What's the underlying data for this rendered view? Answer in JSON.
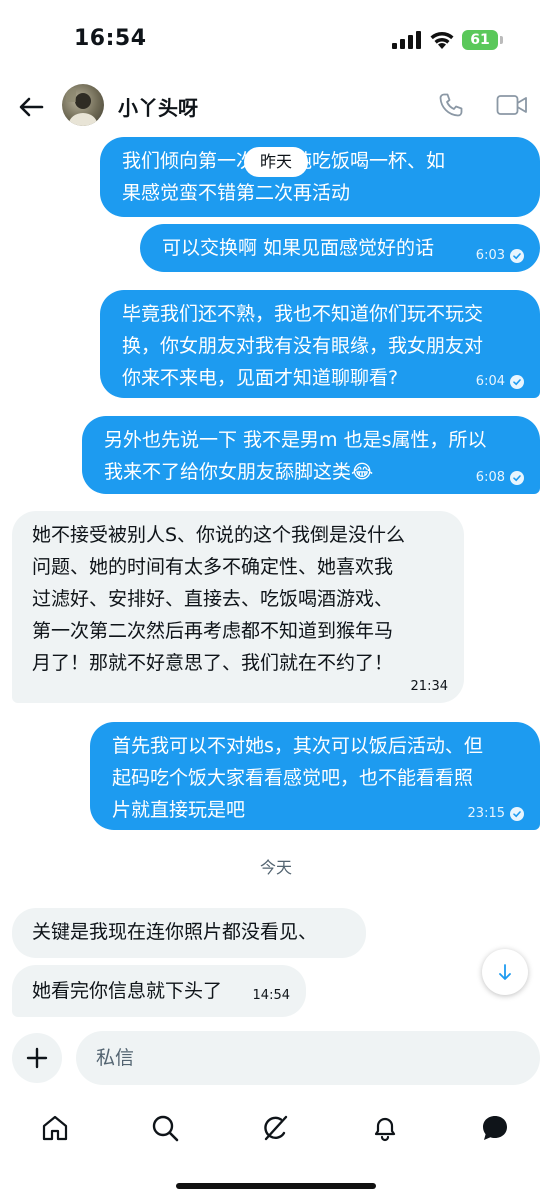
{
  "status_bar": {
    "time": "16:54",
    "battery": "61"
  },
  "header": {
    "contact_name": "小丫头呀",
    "back_icon": "arrow-left-icon",
    "call_icon": "phone-icon",
    "video_icon": "video-camera-icon"
  },
  "day_labels": {
    "yesterday": "昨天",
    "today": "今天"
  },
  "messages": [
    {
      "direction": "out",
      "lines": [
        "我们倾向第一次就单纯吃饭喝一杯、如",
        "果感觉蛮不错第二次再活动"
      ],
      "time": ""
    },
    {
      "direction": "out",
      "lines": [
        "可以交换啊 如果见面感觉好的话"
      ],
      "time": "6:03"
    },
    {
      "direction": "out",
      "lines": [
        "毕竟我们还不熟，我也不知道你们玩不玩交",
        "换，你女朋友对我有没有眼缘，我女朋友对",
        "你来不来电，见面才知道聊聊看?"
      ],
      "time": "6:04"
    },
    {
      "direction": "out",
      "lines": [
        "另外也先说一下 我不是男m 也是s属性，所以",
        "我来不了给你女朋友舔脚这类😂"
      ],
      "time": "6:08"
    },
    {
      "direction": "in",
      "lines": [
        "她不接受被别人S、你说的这个我倒是没什么",
        "问题、她的时间有太多不确定性、她喜欢我",
        "过滤好、安排好、直接去、吃饭喝酒游戏、",
        "第一次第二次然后再考虑都不知道到猴年马",
        "月了！那就不好意思了、我们就在不约了！"
      ],
      "time": "21:34"
    },
    {
      "direction": "out",
      "lines": [
        "首先我可以不对她s，其次可以饭后活动、但",
        "起码吃个饭大家看看感觉吧，也不能看看照",
        "片就直接玩是吧"
      ],
      "time": "23:15"
    },
    {
      "direction": "in",
      "lines": [
        "关键是我现在连你照片都没看见、"
      ],
      "time": ""
    },
    {
      "direction": "in",
      "lines": [
        "她看完你信息就下头了"
      ],
      "time": "14:54"
    }
  ],
  "composer": {
    "placeholder": "私信",
    "add_icon": "plus-icon"
  },
  "bottom_nav": [
    {
      "name": "home",
      "icon": "home-icon"
    },
    {
      "name": "search",
      "icon": "search-icon"
    },
    {
      "name": "grok",
      "icon": "grok-icon"
    },
    {
      "name": "notifications",
      "icon": "bell-icon"
    },
    {
      "name": "messages",
      "icon": "chat-bubble-icon"
    }
  ],
  "colors": {
    "accent": "#1d9bf0",
    "incoming_bubble": "#eff3f4",
    "text": "#0f1419",
    "muted": "#536471"
  }
}
